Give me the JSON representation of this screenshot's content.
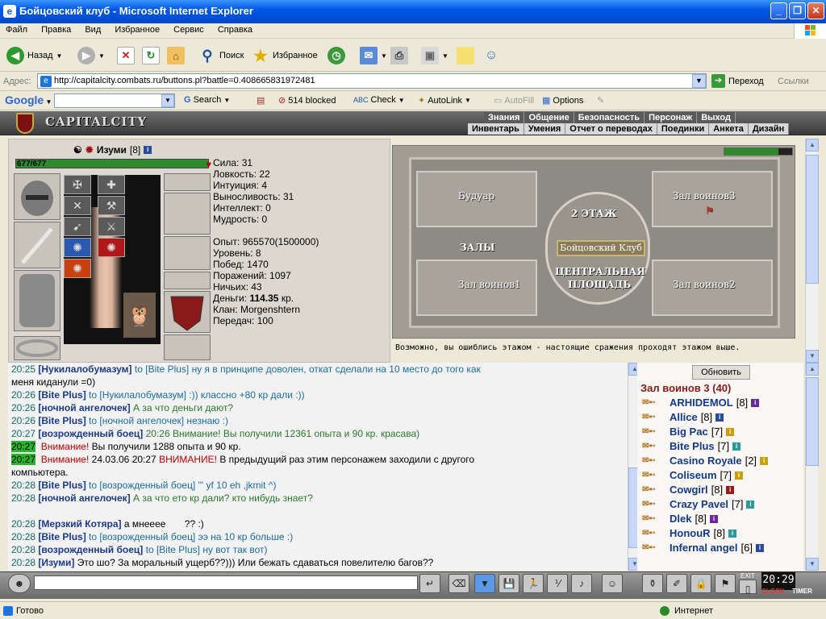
{
  "window": {
    "title": "Бойцовский клуб - Microsoft Internet Explorer"
  },
  "menu": [
    "Файл",
    "Правка",
    "Вид",
    "Избранное",
    "Сервис",
    "Справка"
  ],
  "toolbar": {
    "back": "Назад",
    "search": "Поиск",
    "favorites": "Избранное"
  },
  "address": {
    "label": "Адрес:",
    "url": "http://capitalcity.combats.ru/buttons.pl?battle=0.408665831972481",
    "go": "Переход",
    "links": "Ссылки"
  },
  "google": {
    "logo": "Google",
    "search": "Search",
    "blocked": "514 blocked",
    "check": "Check",
    "autolink": "AutoLink",
    "autofill": "AutoFill",
    "options": "Options"
  },
  "game": {
    "logo": "CAPITALCITY",
    "nav_top": [
      "Знания",
      "Общение",
      "Безопасность",
      "Персонаж",
      "Выход"
    ],
    "nav_bottom": [
      "Инвентарь",
      "Умения",
      "Отчет о переводах",
      "Поединки",
      "Анкета",
      "Дизайн"
    ]
  },
  "character": {
    "name": "Изуми",
    "level": "[8]",
    "hp_text": "677/677",
    "hp_fraction": 1.0,
    "stats": [
      "Сила: 31",
      "Ловкость: 22",
      "Интуиция: 4",
      "Выносливость: 31",
      "Интеллект: 0",
      "Мудрость: 0"
    ],
    "details": [
      "Опыт: 965570(1500000)",
      "Уровень: 8",
      "Побед: 1470",
      "Поражений: 1097",
      "Ничьих: 43"
    ],
    "money_label": "Деньги: ",
    "money_value": "114.35",
    "money_unit": " кр.",
    "clan": "Клан: Morgenshtern",
    "transfers": "Передач: 100"
  },
  "map": {
    "rooms": [
      "Будуар",
      "Зал воинов3",
      "Зал воинов1",
      "Зал воинов2"
    ],
    "floor": "2 ЭТАЖ",
    "banner": "Бойцовский Клуб",
    "halls": "ЗАЛЫ",
    "center_line1": "ЦЕНТРАЛЬНАЯ",
    "center_line2": "ПЛОЩАДЬ",
    "note": "Возможно, вы ошиблись этажом - настоящие сражения проходят этажом выше."
  },
  "chat": {
    "lines": [
      {
        "time": "20:25",
        "parts": [
          [
            "nm",
            "[Нукилалобумазум]"
          ],
          [
            "tgt",
            " to [Bite Plus] ну я в принципе доволен, откат сделали на 10 место до того как"
          ]
        ]
      },
      {
        "time": "",
        "parts": [
          [
            "tn",
            "меня киданули =0)"
          ]
        ]
      },
      {
        "time": "20:26",
        "parts": [
          [
            "nm",
            "[Bite Plus]"
          ],
          [
            "tgt",
            " to [Нукилалобумазум] :)) классно +80 кр дали :))"
          ]
        ]
      },
      {
        "time": "20:26",
        "parts": [
          [
            "nm",
            "[ночной ангелочек]"
          ],
          [
            "g",
            " А за что деньги дают?"
          ]
        ]
      },
      {
        "time": "20:26",
        "parts": [
          [
            "nm",
            "[Bite Plus]"
          ],
          [
            "tgt",
            " to [ночной ангелочек] незнаю :)"
          ]
        ]
      },
      {
        "time": "20:27",
        "parts": [
          [
            "nm",
            "[возрожденный боец]"
          ],
          [
            "g",
            " 20:26 Внимание! Вы получили 12361 опыта и 90 кр. красава)"
          ]
        ]
      },
      {
        "time": "20:27",
        "hl": true,
        "parts": [
          [
            "red",
            " Внимание!"
          ],
          [
            "tn",
            " Вы получили 1288 опыта и 90 кр."
          ]
        ]
      },
      {
        "time": "20:27",
        "hl": true,
        "parts": [
          [
            "red",
            " Внимание!"
          ],
          [
            "tn",
            " 24.03.06 20:27 "
          ],
          [
            "red",
            "ВНИМАНИЕ!"
          ],
          [
            "tn",
            " В предыдущий раз этим персонажем заходили с другого"
          ]
        ]
      },
      {
        "time": "",
        "parts": [
          [
            "tn",
            "компьютера."
          ]
        ]
      },
      {
        "time": "20:28",
        "parts": [
          [
            "nm",
            "[Bite Plus]"
          ],
          [
            "tgt",
            " to [возрожденный боец] \"' yf 10 eh ,jkmit ^)"
          ]
        ]
      },
      {
        "time": "20:28",
        "parts": [
          [
            "nm",
            "[ночной ангелочек]"
          ],
          [
            "g",
            " А за что ето кр дали? кто нибудь знает?"
          ]
        ]
      },
      {
        "time": "",
        "parts": [
          [
            "tn",
            " "
          ]
        ]
      },
      {
        "time": "20:28",
        "parts": [
          [
            "nm",
            "[Мерзкий Котяра]"
          ],
          [
            "tn",
            " а мнееее "
          ],
          [
            "tn",
            "      ?? :)"
          ]
        ]
      },
      {
        "time": "20:28",
        "parts": [
          [
            "nm",
            "[Bite Plus]"
          ],
          [
            "tgt",
            " to [возрожденный боец] ээ на 10 кр больше :)"
          ]
        ]
      },
      {
        "time": "20:28",
        "parts": [
          [
            "nm",
            "[возрожденный боец]"
          ],
          [
            "tgt",
            " to [Bite Plus] ну вот так вот)"
          ]
        ]
      },
      {
        "time": "20:28",
        "parts": [
          [
            "nm",
            "[Изуми]"
          ],
          [
            "tn",
            " Это шо? За моральный ущерб??))) Или бежать сдаваться повелителю багов??"
          ]
        ]
      }
    ]
  },
  "players": {
    "refresh": "Обновить",
    "room_title": "Зал воинов 3 (40)",
    "list": [
      {
        "name": "ARHIDEMOL",
        "level": "[8]",
        "badge": "#6a2a9a"
      },
      {
        "name": "Allice",
        "level": "[8]",
        "badge": "#2c4a9c"
      },
      {
        "name": "Big Pac",
        "level": "[7]",
        "badge": "#c8a000"
      },
      {
        "name": "Bite Plus",
        "level": "[7]",
        "badge": "#2a9a9a"
      },
      {
        "name": "Casino Royale",
        "level": "[2]",
        "badge": "#c8a000"
      },
      {
        "name": "Coliseum",
        "level": "[7]",
        "badge": "#c8a000"
      },
      {
        "name": "Cowgirl",
        "level": "[8]",
        "badge": "#9a1a1a"
      },
      {
        "name": "Crazy Pavel",
        "level": "[7]",
        "badge": "#2a9a9a"
      },
      {
        "name": "Dlek",
        "level": "[8]",
        "badge": "#6a2a9a"
      },
      {
        "name": "HonouR",
        "level": "[8]",
        "badge": "#2a9a9a"
      },
      {
        "name": "Infernal angel",
        "level": "[6]",
        "badge": "#2c4a9c"
      }
    ]
  },
  "clock": {
    "time": "20:29",
    "label": "CLOCK",
    "timer": "TIMER",
    "exit": "EXIT"
  },
  "status": {
    "ready": "Готово",
    "zone": "Интернет"
  }
}
